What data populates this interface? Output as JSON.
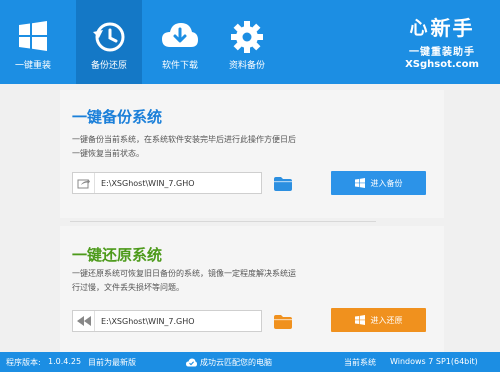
{
  "header": {
    "nav": [
      {
        "label": "一键重装",
        "icon": "windows-icon"
      },
      {
        "label": "备份还原",
        "icon": "history-clock-icon"
      },
      {
        "label": "软件下载",
        "icon": "cloud-download-icon"
      },
      {
        "label": "资料备份",
        "icon": "gear-icon"
      }
    ],
    "brand": {
      "mark": "心",
      "name": "新手",
      "slogan": "一键重装助手",
      "url": "XSghsot.com"
    }
  },
  "backup": {
    "title": "一键备份系统",
    "desc": "一键备份当前系统，在系统软件安装完毕后进行此操作方便日后一键恢复当前状态。",
    "path": "E:\\XSGhost\\WIN_7.GHO",
    "button": "进入备份"
  },
  "restore": {
    "title": "一键还原系统",
    "desc": "一键还原系统可恢复旧日备份的系统，镜像一定程度解决系统运行过慢，文件丢失损坏等问题。",
    "path": "E:\\XSGhost\\WIN_7.GHO",
    "button": "进入还原"
  },
  "status": {
    "version_label": "程序版本:",
    "version": "1.0.4.25",
    "latest": "目前为最新版",
    "sync": "成功云匹配您的电脑",
    "os_label": "当前系统",
    "os": "Windows 7 SP1(64bit)"
  },
  "colors": {
    "header": "#1c8ee3",
    "backup_button": "#2c93e8",
    "restore_button": "#f0911e",
    "backup_title": "#1a7fd9",
    "restore_title": "#4c9a1a",
    "folder": "#2c8fe0",
    "folder_restore": "#f0911e"
  }
}
